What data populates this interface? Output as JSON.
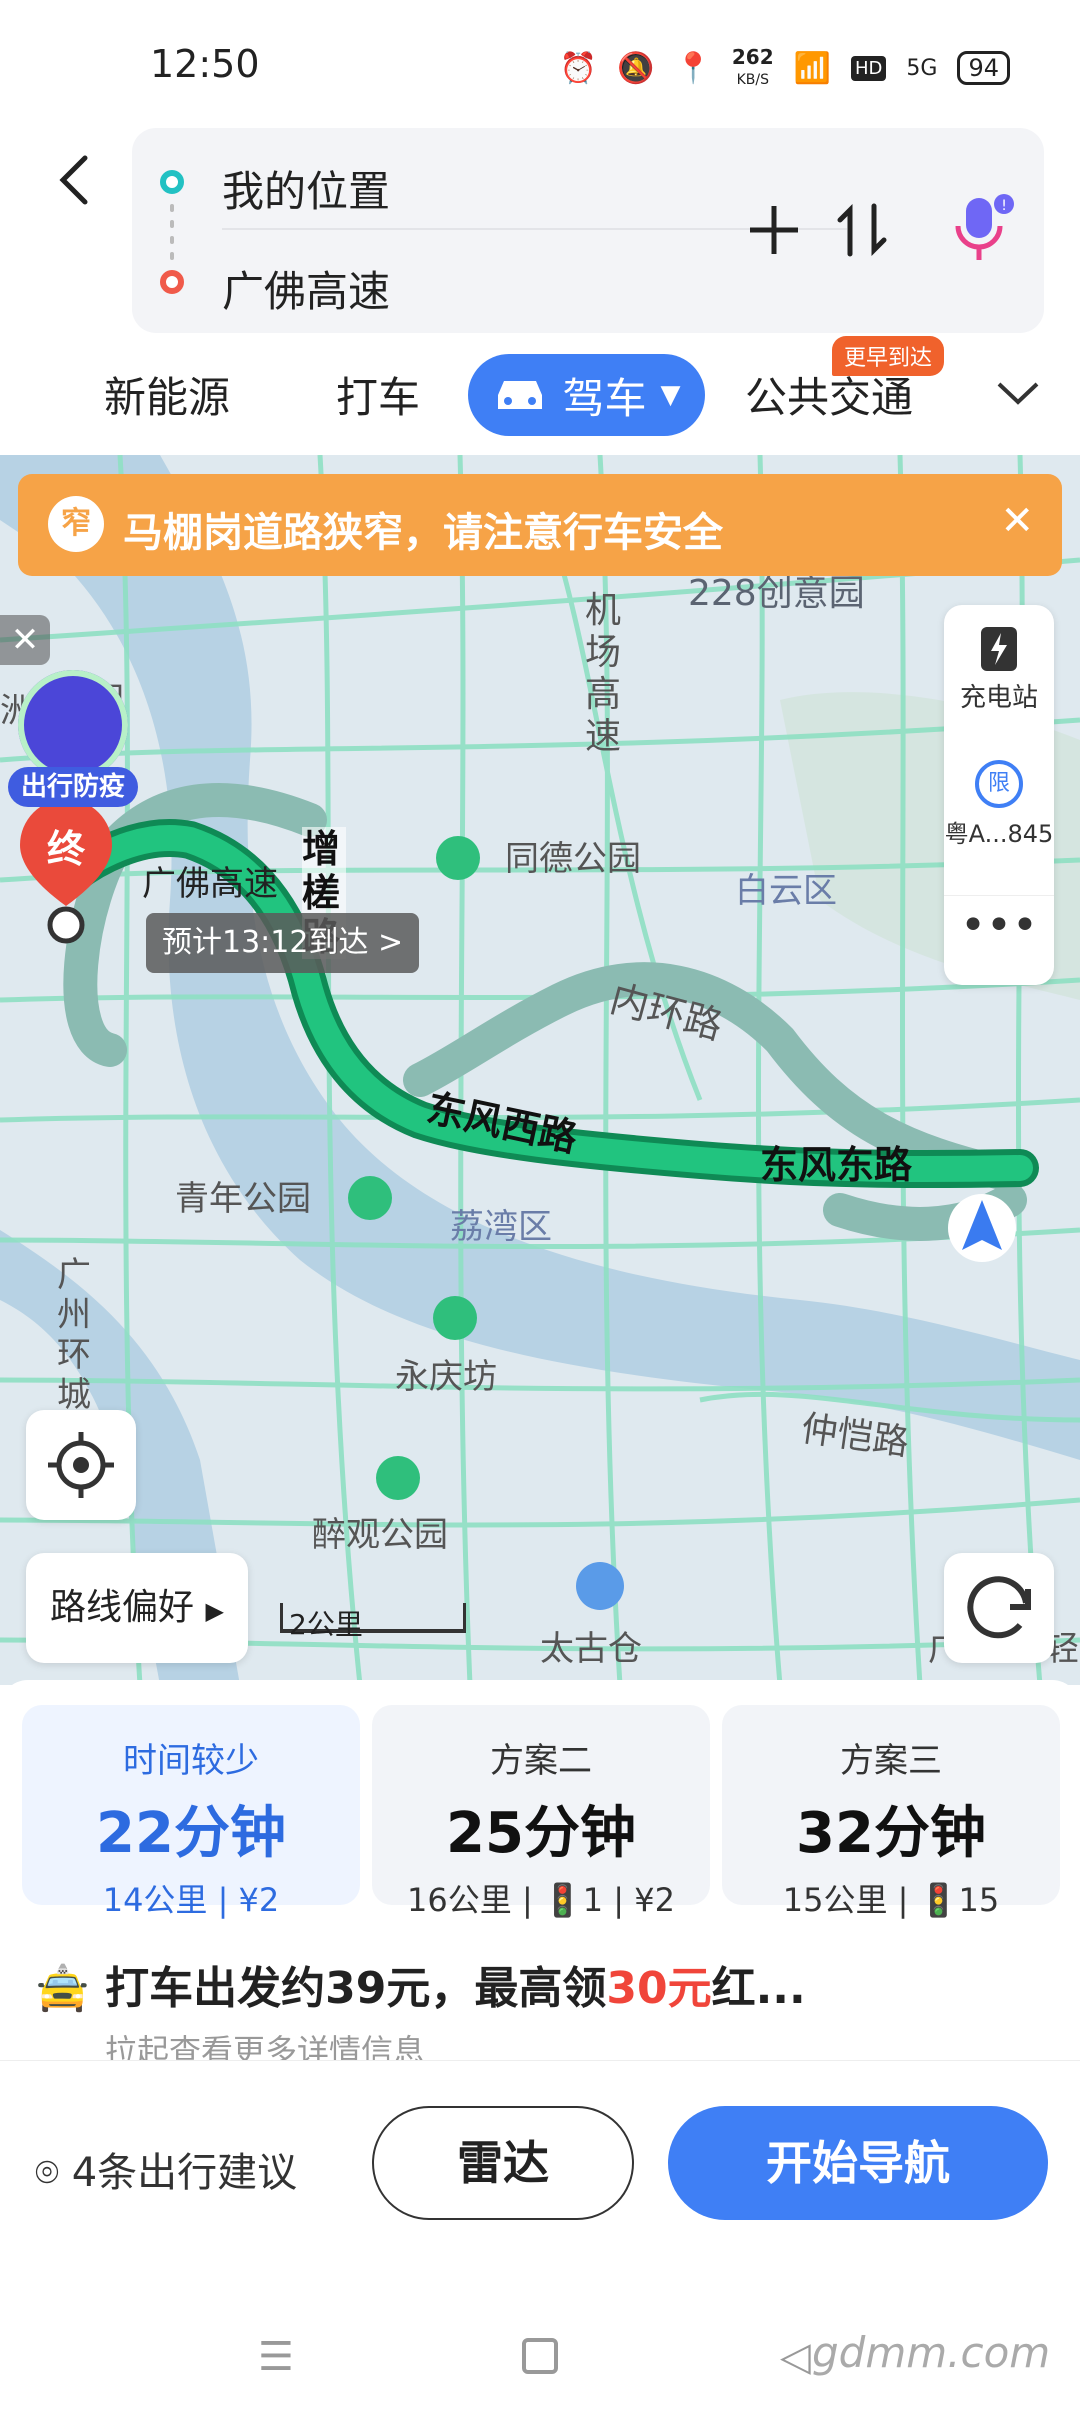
{
  "status_bar": {
    "time": "12:50",
    "speed_value": "262",
    "speed_unit": "KB/S",
    "battery": "94",
    "network": "5G",
    "hd": "HD"
  },
  "route_header": {
    "from": "我的位置",
    "to": "广佛高速"
  },
  "tabs": [
    {
      "label": "新能源"
    },
    {
      "label": "打车"
    },
    {
      "label": "驾车",
      "selected": true
    },
    {
      "label": "公共交通",
      "badge": "更早到达"
    }
  ],
  "alert": {
    "badge": "窄",
    "text": "马棚岗道路狭窄，请注意行车安全"
  },
  "map": {
    "eta_label": "预计13:12到达 >",
    "end_marker": "终",
    "epidemic_label": "出行防疫",
    "scale": "2公里",
    "route_pref": "路线偏好",
    "side_panel": {
      "charge": "充电站",
      "plate": "粤A...845",
      "limit_icon": "限"
    },
    "labels": {
      "p228": "228创意园",
      "airport": "机场高速",
      "tongde": "同德公园",
      "baiyun": "白云区",
      "guangfo": "广佛高速",
      "zengcha": "增槎路",
      "neihuan": "内环路",
      "dongfengxi": "东风西路",
      "dongfengdong": "东风东路",
      "qingnian": "青年公园",
      "liwan": "荔湾区",
      "yongqing": "永庆坊",
      "zhongkai": "仲恺路",
      "zuiguan": "醉观公园",
      "taigucang": "太古仓",
      "huancheng": "广州环城",
      "park_left": "园",
      "zhou": "洲",
      "guang": "广",
      "right_edge": "轻",
      "right_edge2": "广"
    }
  },
  "routes": [
    {
      "label": "时间较少",
      "duration": "22分钟",
      "meta": "14公里 | ¥2",
      "selected": true
    },
    {
      "label": "方案二",
      "duration": "25分钟",
      "meta": "16公里 | 🚦1 | ¥2"
    },
    {
      "label": "方案三",
      "duration": "32分钟",
      "meta": "15公里 | 🚦15"
    }
  ],
  "taxi": {
    "prefix": "打车出发约39元，最高领",
    "highlight": "30元",
    "suffix": "红...",
    "sub": "拉起查看更多详情信息"
  },
  "actions": {
    "suggestion": "4条出行建议",
    "radar": "雷达",
    "start": "开始导航"
  },
  "watermark": "gdmm.com",
  "colors": {
    "accent": "#3f7ff5",
    "alert": "#f6a347",
    "route": "#1fae6e",
    "highlight": "#f0453a"
  }
}
